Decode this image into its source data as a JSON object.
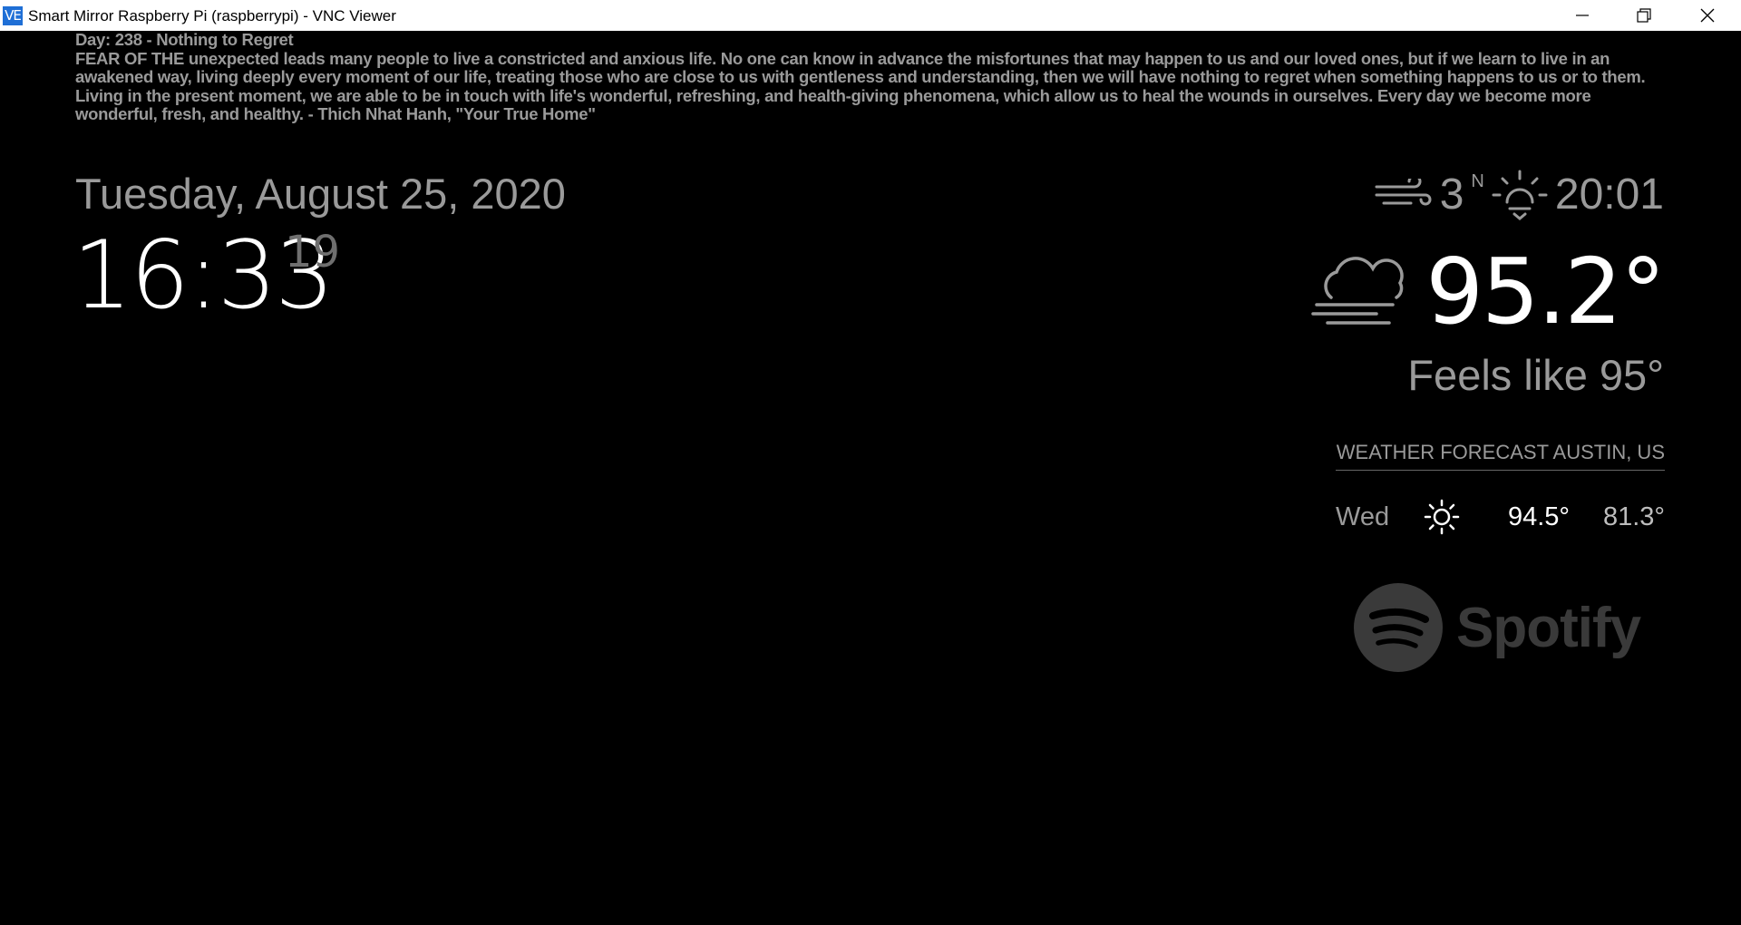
{
  "window": {
    "icon_text": "VE",
    "title": "Smart Mirror Raspberry Pi (raspberrypi) - VNC Viewer"
  },
  "quote": {
    "heading": "Day: 238 - Nothing to Regret",
    "body": "FEAR OF THE unexpected leads many people to live a constricted and anxious life. No one can know in advance the misfortunes that may happen to us and our loved ones, but if we learn to live in an awakened way, living deeply every moment of our life, treating those who are close to us with gentleness and understanding, then we will have nothing to regret when something happens to us or to them. Living in the present moment, we are able to be in touch with life's wonderful, refreshing, and health-giving phenomena, which allow us to heal the wounds in ourselves. Every day we become more wonderful, fresh, and healthy. - Thich Nhat Hanh, \"Your True Home\""
  },
  "clock": {
    "date": "Tuesday, August 25, 2020",
    "time": "16:33",
    "seconds": "19"
  },
  "weather": {
    "wind_speed": "3",
    "wind_direction": "N",
    "sun_time": "20:01",
    "current_icon": "cloud-fog-icon",
    "temperature": "95.2°",
    "feels_like": "Feels like 95°",
    "forecast_header": "WEATHER FORECAST AUSTIN, US",
    "forecast": [
      {
        "day": "Wed",
        "icon": "sun-icon",
        "max": "94.5°",
        "min": "81.3°"
      }
    ]
  },
  "spotify": {
    "label": "Spotify"
  },
  "colors": {
    "background": "#000000",
    "dim_text": "#9a9a9a",
    "bright_text": "#ffffff",
    "spotify_logo": "#3a3a3a"
  }
}
